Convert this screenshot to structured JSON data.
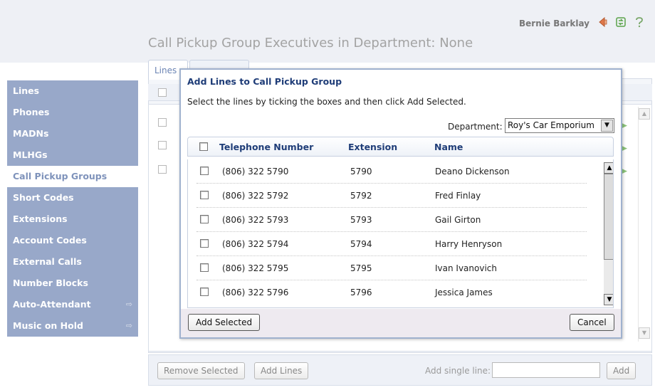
{
  "header": {
    "user_name": "Bernie Barklay",
    "page_title": "Call Pickup Group Executives in Department: None",
    "icons": [
      "back-icon",
      "refresh-icon",
      "help-icon"
    ]
  },
  "sidebar": {
    "items": [
      {
        "label": "Lines"
      },
      {
        "label": "Phones"
      },
      {
        "label": "MADNs"
      },
      {
        "label": "MLHGs"
      },
      {
        "label": "Call Pickup Groups",
        "active": true
      },
      {
        "label": "Short Codes"
      },
      {
        "label": "Extensions"
      },
      {
        "label": "Account Codes"
      },
      {
        "label": "External Calls"
      },
      {
        "label": "Number Blocks"
      },
      {
        "label": "Auto-Attendant",
        "external": true
      },
      {
        "label": "Music on Hold",
        "external": true
      }
    ]
  },
  "background": {
    "tab_lines": "Lines",
    "remove_selected": "Remove Selected",
    "add_lines": "Add Lines",
    "add_single_label": "Add single line:",
    "add_single_value": "",
    "add_button": "Add"
  },
  "modal": {
    "title": "Add Lines to Call Pickup Group",
    "instruction": "Select the lines by ticking the boxes and then click Add Selected.",
    "department_label": "Department:",
    "department_value": "Roy's Car Emporium",
    "columns": {
      "telephone": "Telephone Number",
      "extension": "Extension",
      "name": "Name"
    },
    "rows": [
      {
        "telephone": "(806) 322 5790",
        "extension": "5790",
        "name": "Deano Dickenson"
      },
      {
        "telephone": "(806) 322 5792",
        "extension": "5792",
        "name": "Fred Finlay"
      },
      {
        "telephone": "(806) 322 5793",
        "extension": "5793",
        "name": "Gail Girton"
      },
      {
        "telephone": "(806) 322 5794",
        "extension": "5794",
        "name": "Harry Henryson"
      },
      {
        "telephone": "(806) 322 5795",
        "extension": "5795",
        "name": "Ivan Ivanovich"
      },
      {
        "telephone": "(806) 322 5796",
        "extension": "5796",
        "name": "Jessica James"
      }
    ],
    "add_selected": "Add Selected",
    "cancel": "Cancel"
  },
  "colors": {
    "sidebar_bg": "#98a8c9",
    "sidebar_active_text": "#7f93bb",
    "modal_title": "#1f3d78",
    "modal_border": "#9fb1ce"
  }
}
